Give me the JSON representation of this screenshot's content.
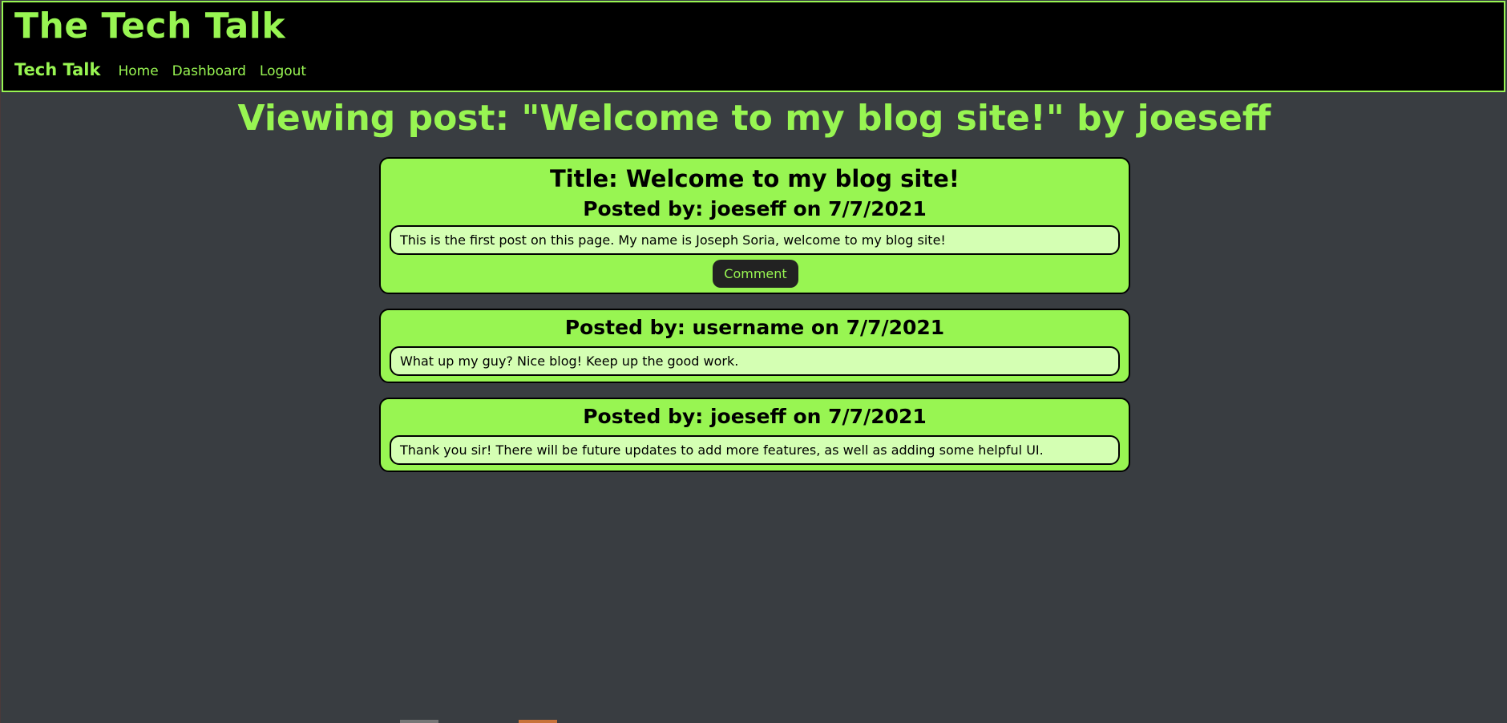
{
  "header": {
    "site_title": "The Tech Talk",
    "brand": "Tech Talk",
    "nav": [
      {
        "label": "Home"
      },
      {
        "label": "Dashboard"
      },
      {
        "label": "Logout"
      }
    ]
  },
  "page": {
    "heading": "Viewing post: \"Welcome to my blog site!\" by joeseff"
  },
  "post": {
    "title": "Title: Welcome to my blog site!",
    "byline": "Posted by: joeseff on 7/7/2021",
    "content": "This is the first post on this page. My name is Joseph Soria, welcome to my blog site!",
    "comment_button_label": "Comment"
  },
  "comments": [
    {
      "byline": "Posted by: username on 7/7/2021",
      "content": "What up my guy? Nice blog! Keep up the good work."
    },
    {
      "byline": "Posted by: joeseff on 7/7/2021",
      "content": "Thank you sir! There will be future updates to add more features, as well as adding some helpful UI."
    }
  ],
  "colors": {
    "accent": "#98f552",
    "background": "#393d41",
    "header_background": "#000000",
    "content_box": "#d4ffb3",
    "button_background": "#222222"
  }
}
